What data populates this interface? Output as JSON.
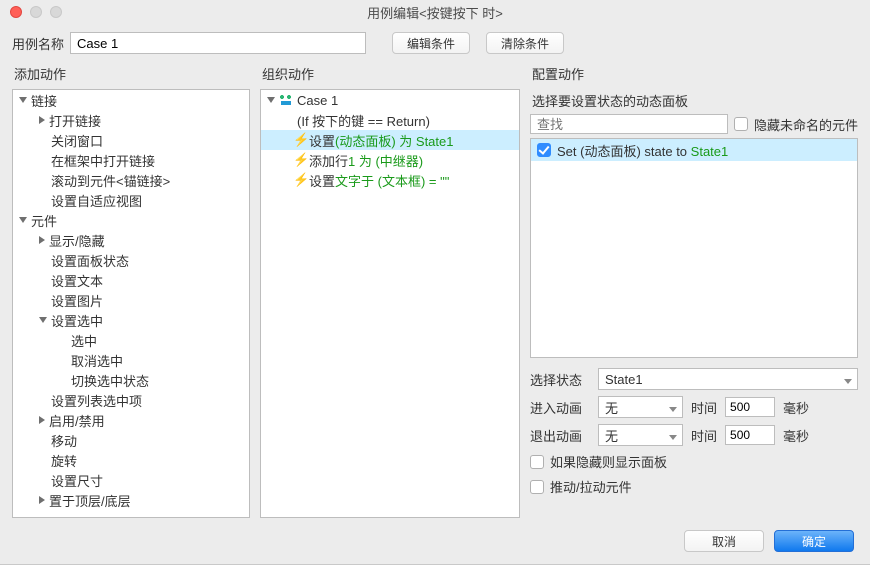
{
  "window": {
    "title": "用例编辑<按键按下 时>"
  },
  "top": {
    "case_name_label": "用例名称",
    "case_name_value": "Case 1",
    "edit_condition": "编辑条件",
    "clear_condition": "清除条件"
  },
  "columns": {
    "left_head": "添加动作",
    "mid_head": "组织动作",
    "right_head": "配置动作"
  },
  "left_tree": {
    "links": {
      "group_label": "链接",
      "open_link": "打开链接",
      "close_window": "关闭窗口",
      "open_in_frame": "在框架中打开链接",
      "scroll_to_anchor": "滚动到元件<锚链接>",
      "adaptive_view": "设置自适应视图"
    },
    "widgets": {
      "group_label": "元件",
      "show_hide": "显示/隐藏",
      "panel_state": "设置面板状态",
      "set_text": "设置文本",
      "set_image": "设置图片",
      "set_selected_group": "设置选中",
      "select": "选中",
      "deselect": "取消选中",
      "toggle_select": "切换选中状态",
      "list_option": "设置列表选中项",
      "enable_disable": "启用/禁用",
      "move": "移动",
      "rotate": "旋转",
      "set_size": "设置尺寸",
      "bring_front_back": "置于顶层/底层"
    }
  },
  "mid_tree": {
    "case_label": "Case 1",
    "condition": "(If 按下的键 == Return)",
    "a1_prefix": "设置 ",
    "a1_green": "(动态面板) 为 State1",
    "a2_prefix": "添加行 ",
    "a2_green": "1 为 (中继器)",
    "a3_prefix": "设置 ",
    "a3_green": "文字于 (文本框) = \"\""
  },
  "right": {
    "subhead": "选择要设置状态的动态面板",
    "search_placeholder": "查找",
    "hide_unnamed": "隐藏未命名的元件",
    "target_prefix": "Set (动态面板) state to ",
    "target_state": "State1",
    "select_state_label": "选择状态",
    "selected_state": "State1",
    "anim_in_label": "进入动画",
    "anim_out_label": "退出动画",
    "anim_none": "无",
    "time_label": "时间",
    "time_in_value": "500",
    "time_out_value": "500",
    "ms_unit": "毫秒",
    "show_if_hidden": "如果隐藏则显示面板",
    "push_pull": "推动/拉动元件"
  },
  "footer": {
    "cancel": "取消",
    "ok": "确定"
  }
}
